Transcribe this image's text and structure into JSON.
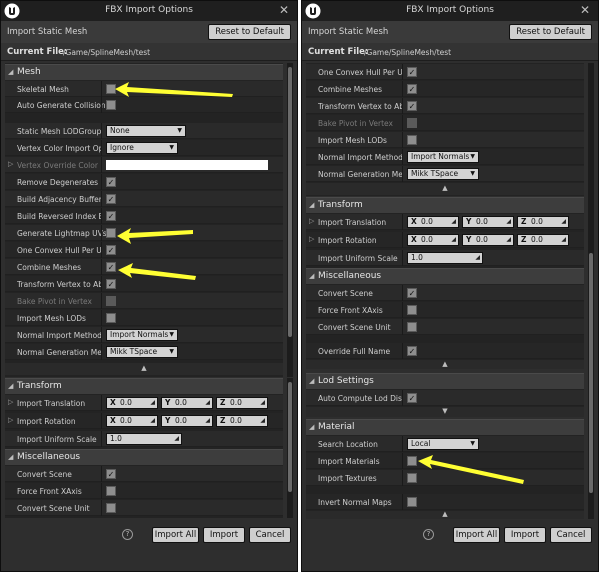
{
  "window": {
    "title": "FBX Import Options",
    "sub_title": "Import Static Mesh",
    "reset_label": "Reset to Default",
    "current_file_label": "Current File:",
    "current_file_path": "/Game/SplineMesh/test",
    "close_glyph": "✕"
  },
  "footer": {
    "help_glyph": "?",
    "import_all": "Import All",
    "import": "Import",
    "cancel": "Cancel"
  },
  "glyphs": {
    "collapse": "◢",
    "expand": "▷",
    "dropdown": "▼",
    "more": "▲",
    "less": "▼",
    "check": "✓",
    "grip": "◢"
  },
  "left": {
    "mesh": {
      "category": "Mesh",
      "skeletal_mesh": "Skeletal Mesh",
      "auto_generate_collision": "Auto Generate Collision",
      "lod_group": "Static Mesh LODGroup",
      "lod_group_value": "None",
      "vertex_color_import": "Vertex Color Import Opti",
      "vertex_color_value": "Ignore",
      "vertex_override_color": "Vertex Override Color",
      "remove_degenerates": "Remove Degenerates",
      "build_adjacency": "Build Adjacency Buffer",
      "build_reversed_index": "Build Reversed Index Bu",
      "generate_lightmap_uvs": "Generate Lightmap UVs",
      "one_convex_hull": "One Convex Hull Per UC",
      "combine_meshes": "Combine Meshes",
      "transform_vertex": "Transform Vertex to Abs",
      "bake_pivot": "Bake Pivot in Vertex",
      "import_mesh_lods": "Import Mesh LODs",
      "normal_import_method": "Normal Import Method",
      "normal_import_value": "Import Normals",
      "normal_generation": "Normal Generation Meth",
      "normal_generation_value": "Mikk TSpace"
    },
    "transform": {
      "category": "Transform",
      "translation": "Import Translation",
      "rotation": "Import Rotation",
      "uniform_scale": "Import Uniform Scale",
      "x_label": "X",
      "y_label": "Y",
      "z_label": "Z",
      "zero": "0.0",
      "scale_value": "1.0"
    },
    "misc": {
      "category": "Miscellaneous",
      "convert_scene": "Convert Scene",
      "force_front_x": "Force Front XAxis",
      "convert_scene_unit": "Convert Scene Unit"
    }
  },
  "right": {
    "mesh": {
      "one_convex_hull": "One Convex Hull Per UC",
      "combine_meshes": "Combine Meshes",
      "transform_vertex": "Transform Vertex to Abs",
      "bake_pivot": "Bake Pivot in Vertex",
      "import_mesh_lods": "Import Mesh LODs",
      "normal_import_method": "Normal Import Method",
      "normal_import_value": "Import Normals",
      "normal_generation": "Normal Generation Meth",
      "normal_generation_value": "Mikk TSpace"
    },
    "transform": {
      "category": "Transform",
      "translation": "Import Translation",
      "rotation": "Import Rotation",
      "uniform_scale": "Import Uniform Scale",
      "x_label": "X",
      "y_label": "Y",
      "z_label": "Z",
      "zero": "0.0",
      "scale_value": "1.0"
    },
    "misc": {
      "category": "Miscellaneous",
      "convert_scene": "Convert Scene",
      "force_front_x": "Force Front XAxis",
      "convert_scene_unit": "Convert Scene Unit",
      "override_full_name": "Override Full Name"
    },
    "lod": {
      "category": "Lod Settings",
      "auto_compute": "Auto Compute Lod Dista"
    },
    "material": {
      "category": "Material",
      "search_location": "Search Location",
      "search_location_value": "Local",
      "import_materials": "Import Materials",
      "import_textures": "Import Textures",
      "invert_normal_maps": "Invert Normal Maps"
    }
  },
  "colors": {
    "annotation_arrow": "#ffff33",
    "window_bg": "#2e2e2e",
    "panel_bg": "#232323",
    "button_bg": "#cfcfcf"
  }
}
